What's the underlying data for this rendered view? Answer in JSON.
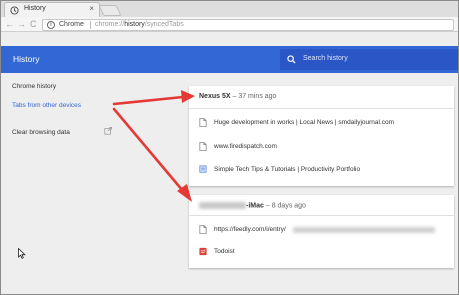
{
  "tab": {
    "title": "History",
    "close_glyph": "×"
  },
  "toolbar": {
    "back_glyph": "←",
    "forward_glyph": "→",
    "reload_glyph": "C",
    "info_glyph": "i",
    "chip_label": "Chrome",
    "url_prefix": "chrome://",
    "url_host": "history",
    "url_path": "/syncedTabs"
  },
  "header": {
    "title": "History",
    "search_placeholder": "Search history"
  },
  "sidebar": {
    "items": [
      {
        "label": "Chrome history"
      },
      {
        "label": "Tabs from other devices"
      },
      {
        "label": "Clear browsing data"
      }
    ]
  },
  "devices": [
    {
      "name": "Nexus 5X",
      "time": " – 37 mins ago",
      "tabs": [
        {
          "title": "Huge development in works | Local News | smdailyjournal.com",
          "icon": "page-icon"
        },
        {
          "title": "www.firedispatch.com",
          "icon": "page-icon"
        },
        {
          "title": "Simple Tech Tips & Tutorials | Productivity Portfolio",
          "icon": "site-icon"
        }
      ]
    },
    {
      "name": "-iMac",
      "time": " – 8 days ago",
      "tabs": [
        {
          "title": "https://feedly.com/i/entry/",
          "icon": "page-icon"
        },
        {
          "title": "Todoist",
          "icon": "todoist-icon"
        }
      ]
    }
  ],
  "colors": {
    "header_blue": "#3367d6",
    "search_blue": "#2a56c6",
    "active_link": "#3367d6",
    "annotation_red": "#e53935",
    "todoist_red": "#db4035"
  }
}
